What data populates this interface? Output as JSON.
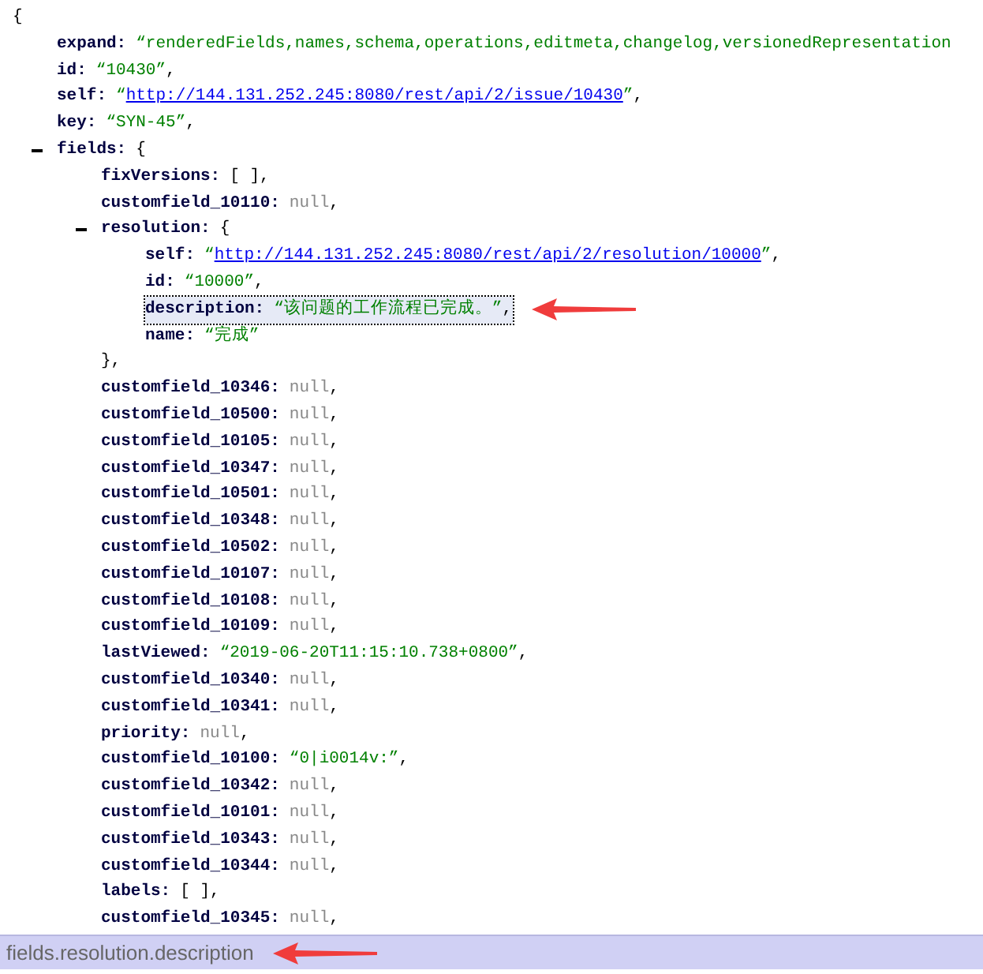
{
  "tree": {
    "open": "{",
    "children": [
      {
        "key": "expand:",
        "selected": false,
        "tokens": [
          {
            "kind": "string",
            "text": "“renderedFields,names,schema,operations,editmeta,changelog,versionedRepresentation"
          }
        ]
      },
      {
        "key": "id:",
        "selected": false,
        "tokens": [
          {
            "kind": "string",
            "text": "“10430”"
          },
          {
            "kind": "punct",
            "text": ","
          }
        ]
      },
      {
        "key": "self:",
        "selected": false,
        "tokens": [
          {
            "kind": "string",
            "text": "“"
          },
          {
            "kind": "link",
            "text": "http://144.131.252.245:8080/rest/api/2/issue/10430"
          },
          {
            "kind": "string",
            "text": "”"
          },
          {
            "kind": "punct",
            "text": ","
          }
        ]
      },
      {
        "key": "key:",
        "selected": false,
        "tokens": [
          {
            "kind": "string",
            "text": "“SYN-45”"
          },
          {
            "kind": "punct",
            "text": ","
          }
        ]
      },
      {
        "key": "fields:",
        "selected": false,
        "expanded": true,
        "tokens": [
          {
            "kind": "punct",
            "text": "{"
          }
        ],
        "children": [
          {
            "key": "fixVersions:",
            "selected": false,
            "tokens": [
              {
                "kind": "punct",
                "text": "[ ],"
              }
            ]
          },
          {
            "key": "customfield_10110:",
            "selected": false,
            "tokens": [
              {
                "kind": "null",
                "text": "null"
              },
              {
                "kind": "punct",
                "text": ","
              }
            ]
          },
          {
            "key": "resolution:",
            "selected": false,
            "expanded": true,
            "tokens": [
              {
                "kind": "punct",
                "text": "{"
              }
            ],
            "close": "},",
            "children": [
              {
                "key": "self:",
                "selected": false,
                "tokens": [
                  {
                    "kind": "string",
                    "text": "“"
                  },
                  {
                    "kind": "link",
                    "text": "http://144.131.252.245:8080/rest/api/2/resolution/10000"
                  },
                  {
                    "kind": "string",
                    "text": "”"
                  },
                  {
                    "kind": "punct",
                    "text": ","
                  }
                ]
              },
              {
                "key": "id:",
                "selected": false,
                "tokens": [
                  {
                    "kind": "string",
                    "text": "“10000”"
                  },
                  {
                    "kind": "punct",
                    "text": ","
                  }
                ]
              },
              {
                "key": "description:",
                "selected": true,
                "annotated": true,
                "tokens": [
                  {
                    "kind": "string",
                    "text": "“该问题的工作流程已完成。”"
                  },
                  {
                    "kind": "punct",
                    "text": ","
                  }
                ]
              },
              {
                "key": "name:",
                "selected": false,
                "tokens": [
                  {
                    "kind": "string",
                    "text": "“完成”"
                  }
                ]
              }
            ]
          },
          {
            "key": "customfield_10346:",
            "selected": false,
            "tokens": [
              {
                "kind": "null",
                "text": "null"
              },
              {
                "kind": "punct",
                "text": ","
              }
            ]
          },
          {
            "key": "customfield_10500:",
            "selected": false,
            "tokens": [
              {
                "kind": "null",
                "text": "null"
              },
              {
                "kind": "punct",
                "text": ","
              }
            ]
          },
          {
            "key": "customfield_10105:",
            "selected": false,
            "tokens": [
              {
                "kind": "null",
                "text": "null"
              },
              {
                "kind": "punct",
                "text": ","
              }
            ]
          },
          {
            "key": "customfield_10347:",
            "selected": false,
            "tokens": [
              {
                "kind": "null",
                "text": "null"
              },
              {
                "kind": "punct",
                "text": ","
              }
            ]
          },
          {
            "key": "customfield_10501:",
            "selected": false,
            "tokens": [
              {
                "kind": "null",
                "text": "null"
              },
              {
                "kind": "punct",
                "text": ","
              }
            ]
          },
          {
            "key": "customfield_10348:",
            "selected": false,
            "tokens": [
              {
                "kind": "null",
                "text": "null"
              },
              {
                "kind": "punct",
                "text": ","
              }
            ]
          },
          {
            "key": "customfield_10502:",
            "selected": false,
            "tokens": [
              {
                "kind": "null",
                "text": "null"
              },
              {
                "kind": "punct",
                "text": ","
              }
            ]
          },
          {
            "key": "customfield_10107:",
            "selected": false,
            "tokens": [
              {
                "kind": "null",
                "text": "null"
              },
              {
                "kind": "punct",
                "text": ","
              }
            ]
          },
          {
            "key": "customfield_10108:",
            "selected": false,
            "tokens": [
              {
                "kind": "null",
                "text": "null"
              },
              {
                "kind": "punct",
                "text": ","
              }
            ]
          },
          {
            "key": "customfield_10109:",
            "selected": false,
            "tokens": [
              {
                "kind": "null",
                "text": "null"
              },
              {
                "kind": "punct",
                "text": ","
              }
            ]
          },
          {
            "key": "lastViewed:",
            "selected": false,
            "tokens": [
              {
                "kind": "string",
                "text": "“2019-06-20T11:15:10.738+0800”"
              },
              {
                "kind": "punct",
                "text": ","
              }
            ]
          },
          {
            "key": "customfield_10340:",
            "selected": false,
            "tokens": [
              {
                "kind": "null",
                "text": "null"
              },
              {
                "kind": "punct",
                "text": ","
              }
            ]
          },
          {
            "key": "customfield_10341:",
            "selected": false,
            "tokens": [
              {
                "kind": "null",
                "text": "null"
              },
              {
                "kind": "punct",
                "text": ","
              }
            ]
          },
          {
            "key": "priority:",
            "selected": false,
            "tokens": [
              {
                "kind": "null",
                "text": "null"
              },
              {
                "kind": "punct",
                "text": ","
              }
            ]
          },
          {
            "key": "customfield_10100:",
            "selected": false,
            "tokens": [
              {
                "kind": "string",
                "text": "“0|i0014v:”"
              },
              {
                "kind": "punct",
                "text": ","
              }
            ]
          },
          {
            "key": "customfield_10342:",
            "selected": false,
            "tokens": [
              {
                "kind": "null",
                "text": "null"
              },
              {
                "kind": "punct",
                "text": ","
              }
            ]
          },
          {
            "key": "customfield_10101:",
            "selected": false,
            "tokens": [
              {
                "kind": "null",
                "text": "null"
              },
              {
                "kind": "punct",
                "text": ","
              }
            ]
          },
          {
            "key": "customfield_10343:",
            "selected": false,
            "tokens": [
              {
                "kind": "null",
                "text": "null"
              },
              {
                "kind": "punct",
                "text": ","
              }
            ]
          },
          {
            "key": "customfield_10344:",
            "selected": false,
            "tokens": [
              {
                "kind": "null",
                "text": "null"
              },
              {
                "kind": "punct",
                "text": ","
              }
            ]
          },
          {
            "key": "labels:",
            "selected": false,
            "tokens": [
              {
                "kind": "punct",
                "text": "[ ],"
              }
            ]
          },
          {
            "key": "customfield_10345:",
            "selected": false,
            "tokens": [
              {
                "kind": "null",
                "text": "null"
              },
              {
                "kind": "punct",
                "text": ","
              }
            ]
          }
        ]
      }
    ]
  },
  "status_bar": {
    "path": "fields.resolution.description",
    "annotated": true
  }
}
